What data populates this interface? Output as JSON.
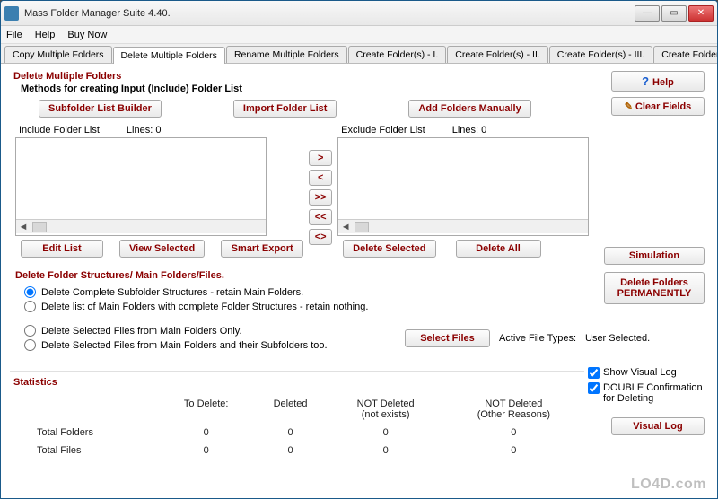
{
  "window": {
    "title": "Mass Folder Manager Suite 4.40."
  },
  "menu": {
    "file": "File",
    "help": "Help",
    "buynow": "Buy Now"
  },
  "tabs": [
    "Copy Multiple Folders",
    "Delete Multiple Folders",
    "Rename Multiple Folders",
    "Create Folder(s)  - I.",
    "Create Folder(s)  - II.",
    "Create Folder(s)  - III.",
    "Create Folder -IV."
  ],
  "active_tab": 1,
  "section": {
    "title": "Delete Multiple Folders",
    "subtitle": "Methods for creating Input (Include) Folder List"
  },
  "buttons": {
    "subfolder_builder": "Subfolder List Builder",
    "import_list": "Import Folder List",
    "add_manually": "Add Folders Manually",
    "help": "Help",
    "clear_fields": "Clear Fields",
    "edit_list": "Edit List",
    "view_selected": "View Selected",
    "smart_export": "Smart Export",
    "delete_selected": "Delete Selected",
    "delete_all": "Delete All",
    "simulation": "Simulation",
    "delete_perm": "Delete Folders\nPERMANENTLY",
    "select_files": "Select Files",
    "visual_log": "Visual Log",
    "move_r": ">",
    "move_l": "<",
    "move_rr": ">>",
    "move_ll": "<<",
    "move_swap": "<>"
  },
  "lists": {
    "include_label": "Include Folder List",
    "exclude_label": "Exclude Folder List",
    "lines_label": "Lines:",
    "include_lines": "0",
    "exclude_lines": "0"
  },
  "delete_struct": {
    "heading": "Delete Folder Structures/ Main Folders/Files.",
    "opt1": "Delete Complete Subfolder Structures - retain Main Folders.",
    "opt2": "Delete list of Main Folders with complete Folder Structures - retain nothing.",
    "opt3": "Delete Selected Files from Main Folders Only.",
    "opt4": "Delete Selected Files from Main Folders and their Subfolders too.",
    "selected": 0
  },
  "file_types": {
    "label": "Active File Types:",
    "value": "User Selected."
  },
  "checks": {
    "show_log": "Show Visual Log",
    "double_confirm": "DOUBLE Confirmation for Deleting"
  },
  "stats": {
    "heading": "Statistics",
    "cols": [
      "",
      "To Delete:",
      "Deleted",
      "NOT Deleted\n(not exists)",
      "NOT Deleted\n(Other Reasons)"
    ],
    "rows": [
      {
        "label": "Total Folders",
        "v": [
          "0",
          "0",
          "0",
          "0"
        ]
      },
      {
        "label": "Total Files",
        "v": [
          "0",
          "0",
          "0",
          "0"
        ]
      }
    ]
  },
  "watermark": "LO4D.com"
}
